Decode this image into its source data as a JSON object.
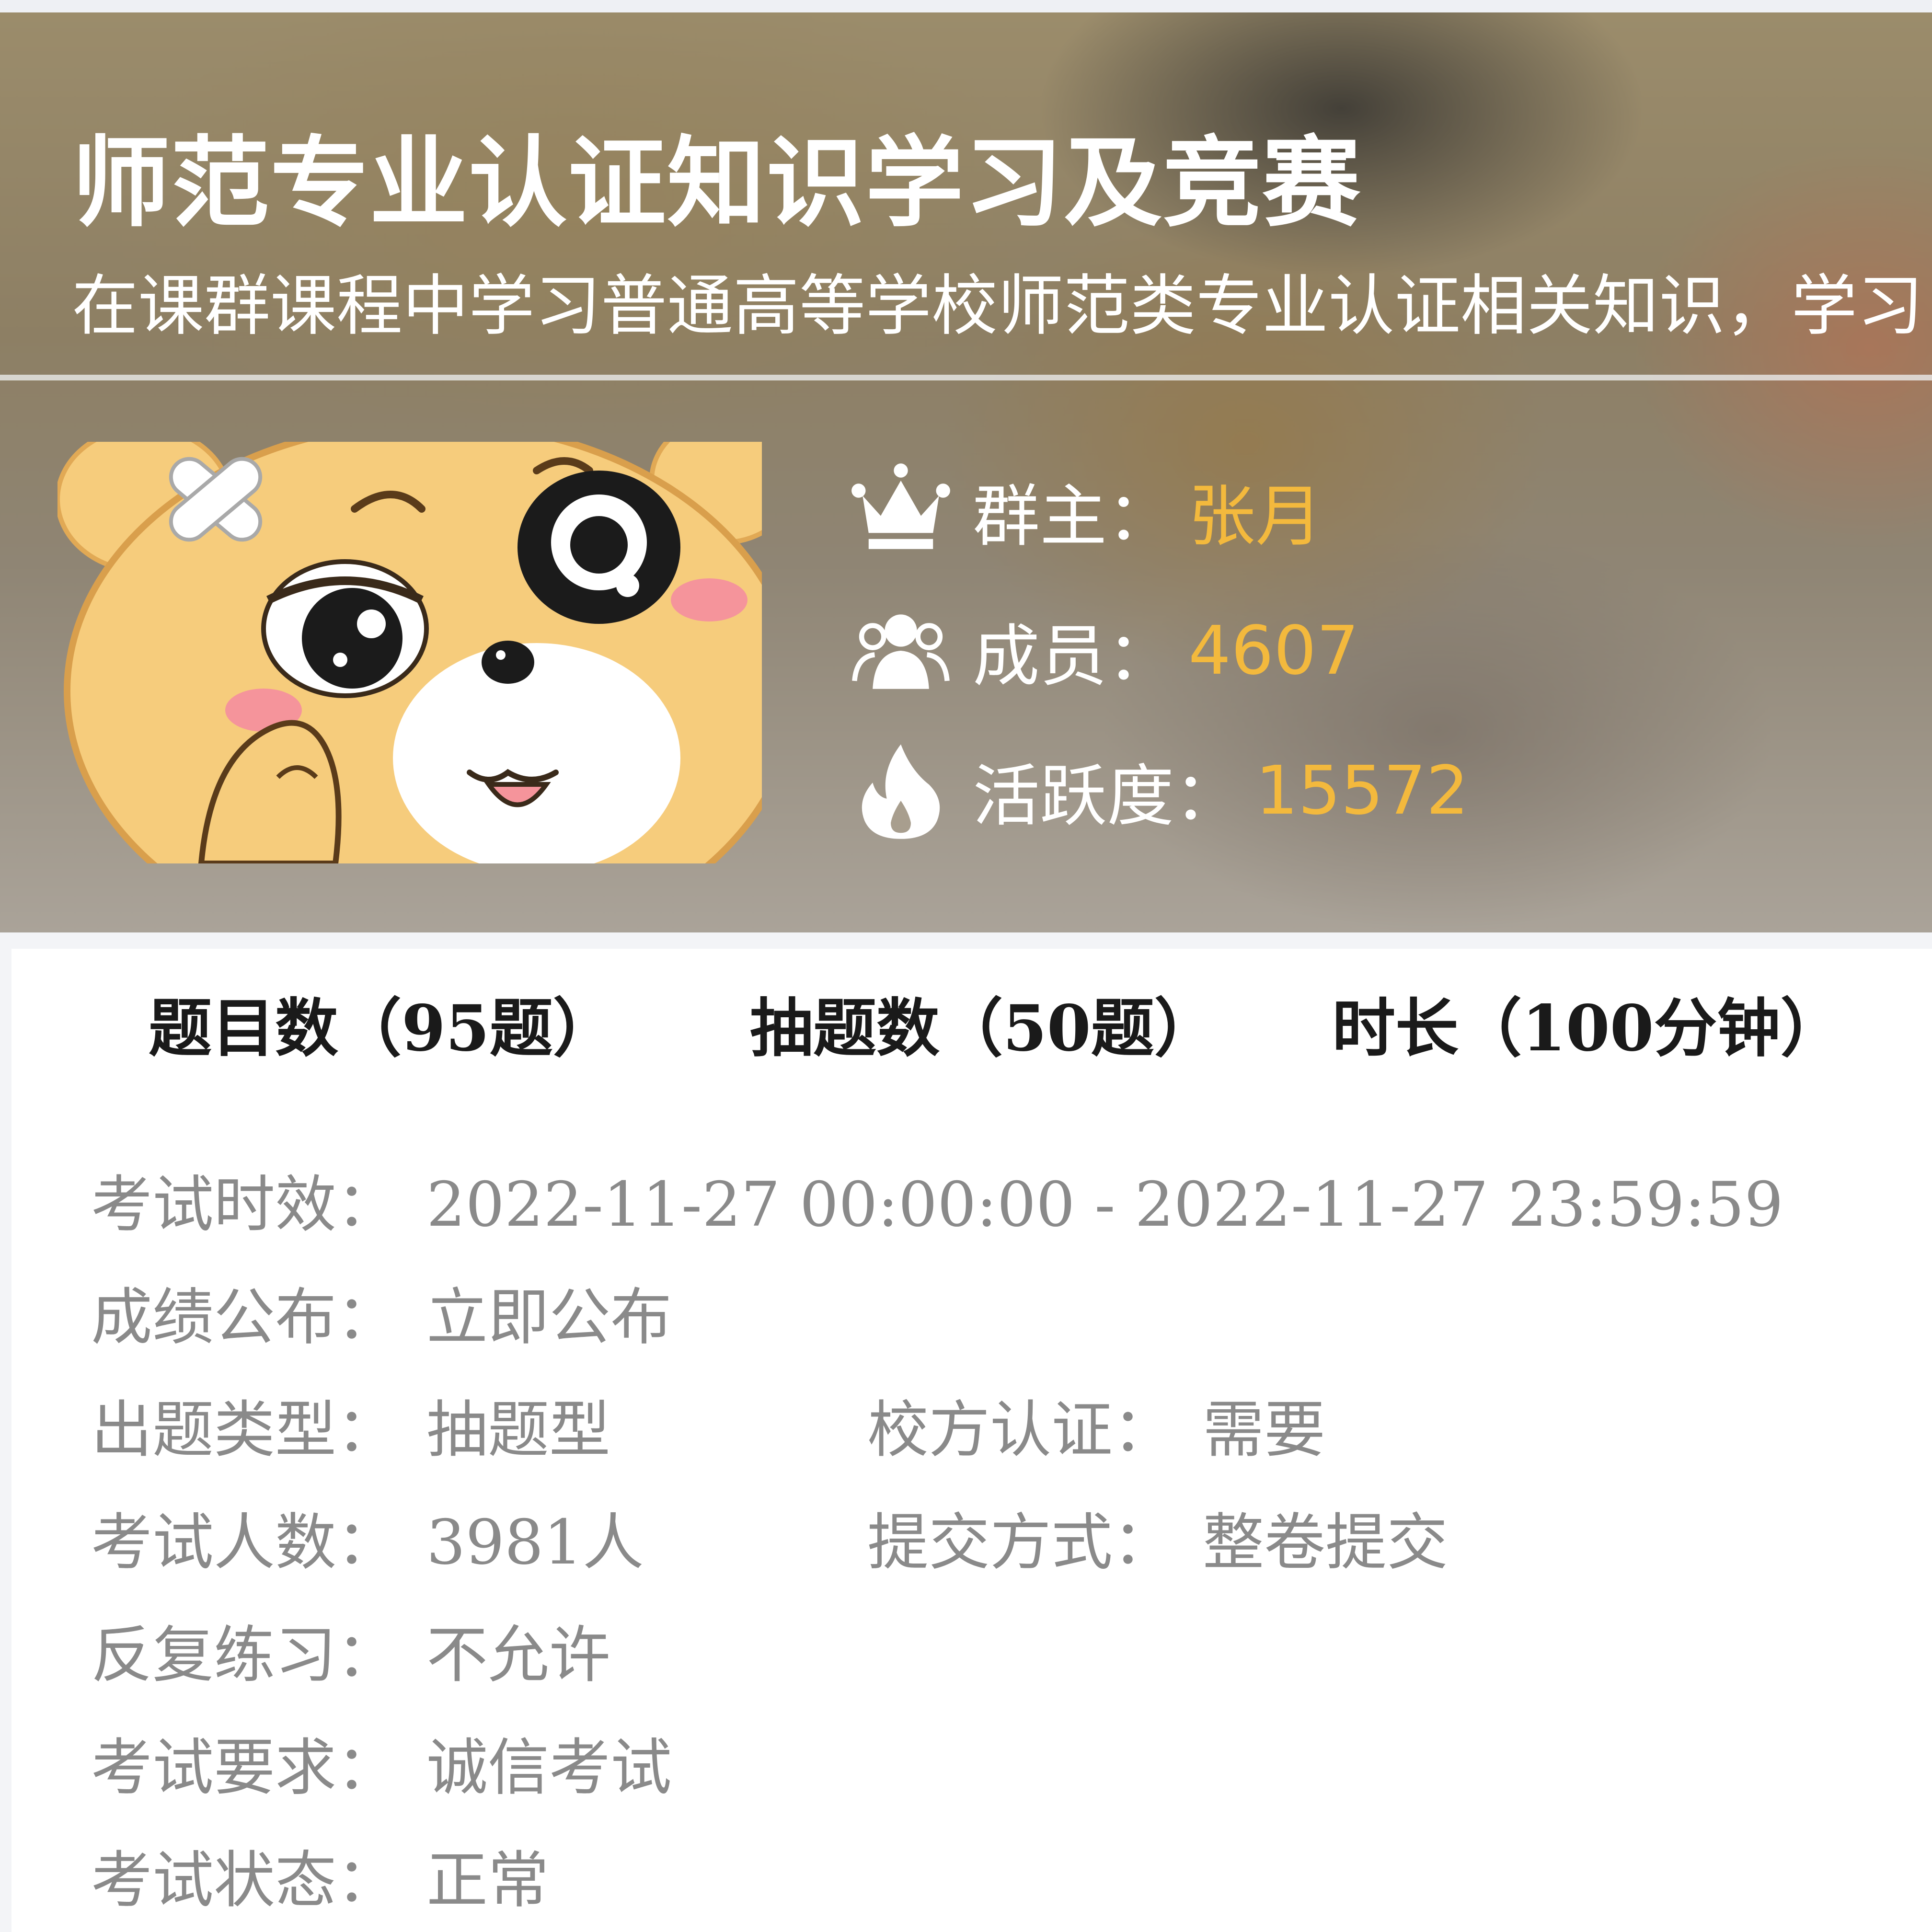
{
  "header": {
    "title": "师范专业认证知识学习及竞赛",
    "subtitle": "在课群课程中学习普通高等学校师范类专业认证相关知识，学习"
  },
  "stats": [
    {
      "icon": "crown-icon",
      "label": "群主：",
      "value": "张月"
    },
    {
      "icon": "members-icon",
      "label": "成员：",
      "value": "4607"
    },
    {
      "icon": "flame-icon",
      "label": "活跃度：",
      "value": "15572"
    }
  ],
  "summary": [
    {
      "label": "题目数（95题）"
    },
    {
      "label": "抽题数（50题）"
    },
    {
      "label": "时长（100分钟）"
    }
  ],
  "details": {
    "time": {
      "label": "考试时效：",
      "value": "2022-11-27 00:00:00 - 2022-11-27 23:59:59"
    },
    "publish": {
      "label": "成绩公布：",
      "value": "立即公布"
    },
    "type": {
      "label": "出题类型：",
      "value": "抽题型"
    },
    "school_auth": {
      "label": "校方认证：",
      "value": "需要"
    },
    "count": {
      "label": "考试人数：",
      "value": "3981人"
    },
    "submit": {
      "label": "提交方式：",
      "value": "整卷提交"
    },
    "repeat": {
      "label": "反复练习：",
      "value": "不允许"
    },
    "requirement": {
      "label": "考试要求：",
      "value": "诚信考试"
    },
    "status": {
      "label": "考试状态：",
      "value": "正常"
    }
  },
  "colors": {
    "accent": "#f3b93d",
    "text_dark": "#1a1a1a",
    "text_muted": "#8a8a8a"
  }
}
